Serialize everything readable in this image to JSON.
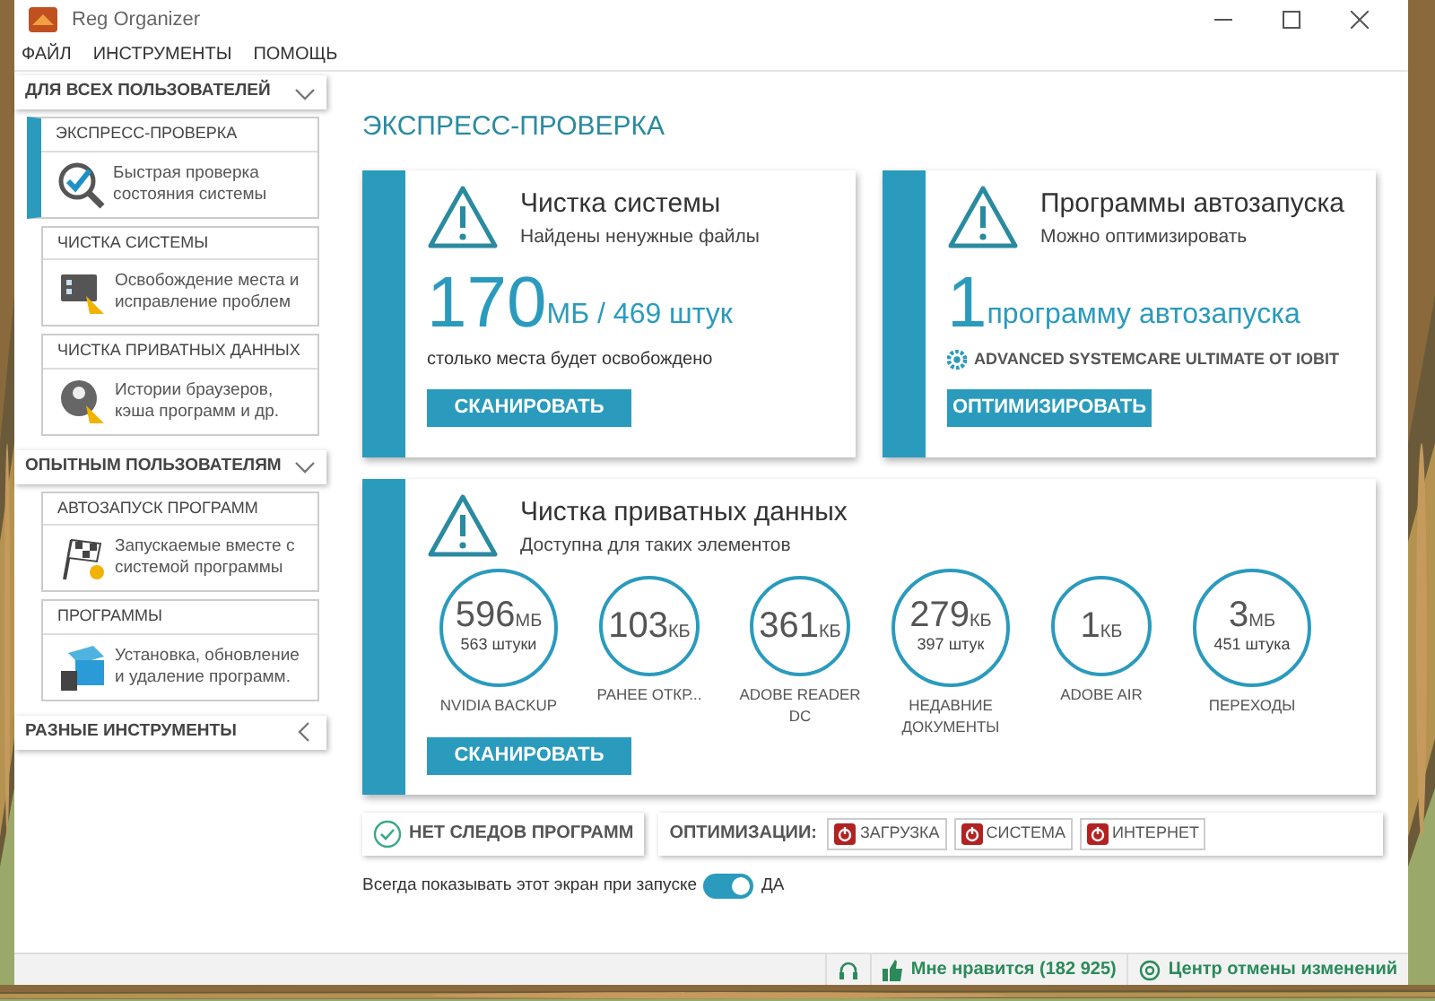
{
  "window": {
    "title": "Reg Organizer"
  },
  "menu": [
    "ФАЙЛ",
    "ИНСТРУМЕНТЫ",
    "ПОМОЩЬ"
  ],
  "sidebar": [
    {
      "title": "ДЛЯ ВСЕХ ПОЛЬЗОВАТЕЛЕЙ",
      "expanded": true,
      "items": [
        {
          "title": "ЭКСПРЕСС-ПРОВЕРКА",
          "text": "Быстрая проверка состояния системы",
          "kind": "check",
          "selected": true
        },
        {
          "title": "ЧИСТКА СИСТЕМЫ",
          "text": "Освобождение места и исправление проблем",
          "kind": "monitor",
          "selected": false
        },
        {
          "title": "ЧИСТКА ПРИВАТНЫХ ДАННЫХ",
          "text": "Истории браузеров, кэша программ и др.",
          "kind": "privacy",
          "selected": false
        }
      ]
    },
    {
      "title": "ОПЫТНЫМ ПОЛЬЗОВАТЕЛЯМ",
      "expanded": true,
      "items": [
        {
          "title": "АВТОЗАПУСК ПРОГРАММ",
          "text": "Запускаемые вместе с системой программы",
          "kind": "flag",
          "selected": false
        },
        {
          "title": "ПРОГРАММЫ",
          "text": "Установка, обновление и удаление программ.",
          "kind": "box",
          "selected": false
        }
      ]
    },
    {
      "title": "РАЗНЫЕ ИНСТРУМЕНТЫ",
      "expanded": false
    }
  ],
  "page_title": "ЭКСПРЕСС-ПРОВЕРКА",
  "cards": [
    {
      "title": "Чистка системы",
      "subtitle": "Найдены ненужные файлы",
      "big": "170",
      "big_rest": "МБ / 469 штук",
      "note": "столько места будет освобождено",
      "button": "СКАНИРОВАТЬ"
    },
    {
      "title": "Программы автозапуска",
      "subtitle": "Можно оптимизировать",
      "big": "1",
      "big_rest": "программу автозапуска",
      "program": "ADVANCED SYSTEMCARE ULTIMATE ОТ IOBIT",
      "button": "ОПТИМИЗИРОВАТЬ"
    }
  ],
  "privacy": {
    "title": "Чистка приватных данных",
    "subtitle": "Доступна для таких элементов",
    "button": "СКАНИРОВАТЬ",
    "items": [
      {
        "value": "596",
        "unit": "МБ",
        "count": "563 штуки",
        "label": "NVIDIA BACKUP"
      },
      {
        "value": "103",
        "unit": "КБ",
        "label": "РАНЕЕ ОТКР..."
      },
      {
        "value": "361",
        "unit": "КБ",
        "label": "ADOBE READER DC"
      },
      {
        "value": "279",
        "unit": "КБ",
        "count": "397 штук",
        "label": "НЕДАВНИЕ ДОКУМЕНТЫ"
      },
      {
        "value": "1",
        "unit": "КБ",
        "label": "ADOBE AIR"
      },
      {
        "value": "3",
        "unit": "МБ",
        "count": "451 штука",
        "label": "ПЕРЕХОДЫ"
      }
    ]
  },
  "traces_button": "НЕТ СЛЕДОВ ПРОГРАММ",
  "optimizations": {
    "label": "ОПТИМИЗАЦИИ:",
    "items": [
      {
        "label": "ЗАГРУЗКА",
        "on": false
      },
      {
        "label": "СИСТЕМА",
        "on": false
      },
      {
        "label": "ИНТЕРНЕТ",
        "on": false
      }
    ]
  },
  "startup_toggle": {
    "label": "Всегда показывать этот экран при запуске",
    "on": true,
    "value": "ДА"
  },
  "status_bar": {
    "likes": "Мне нравится (182 925)",
    "undo": "Центр отмены изменений"
  }
}
